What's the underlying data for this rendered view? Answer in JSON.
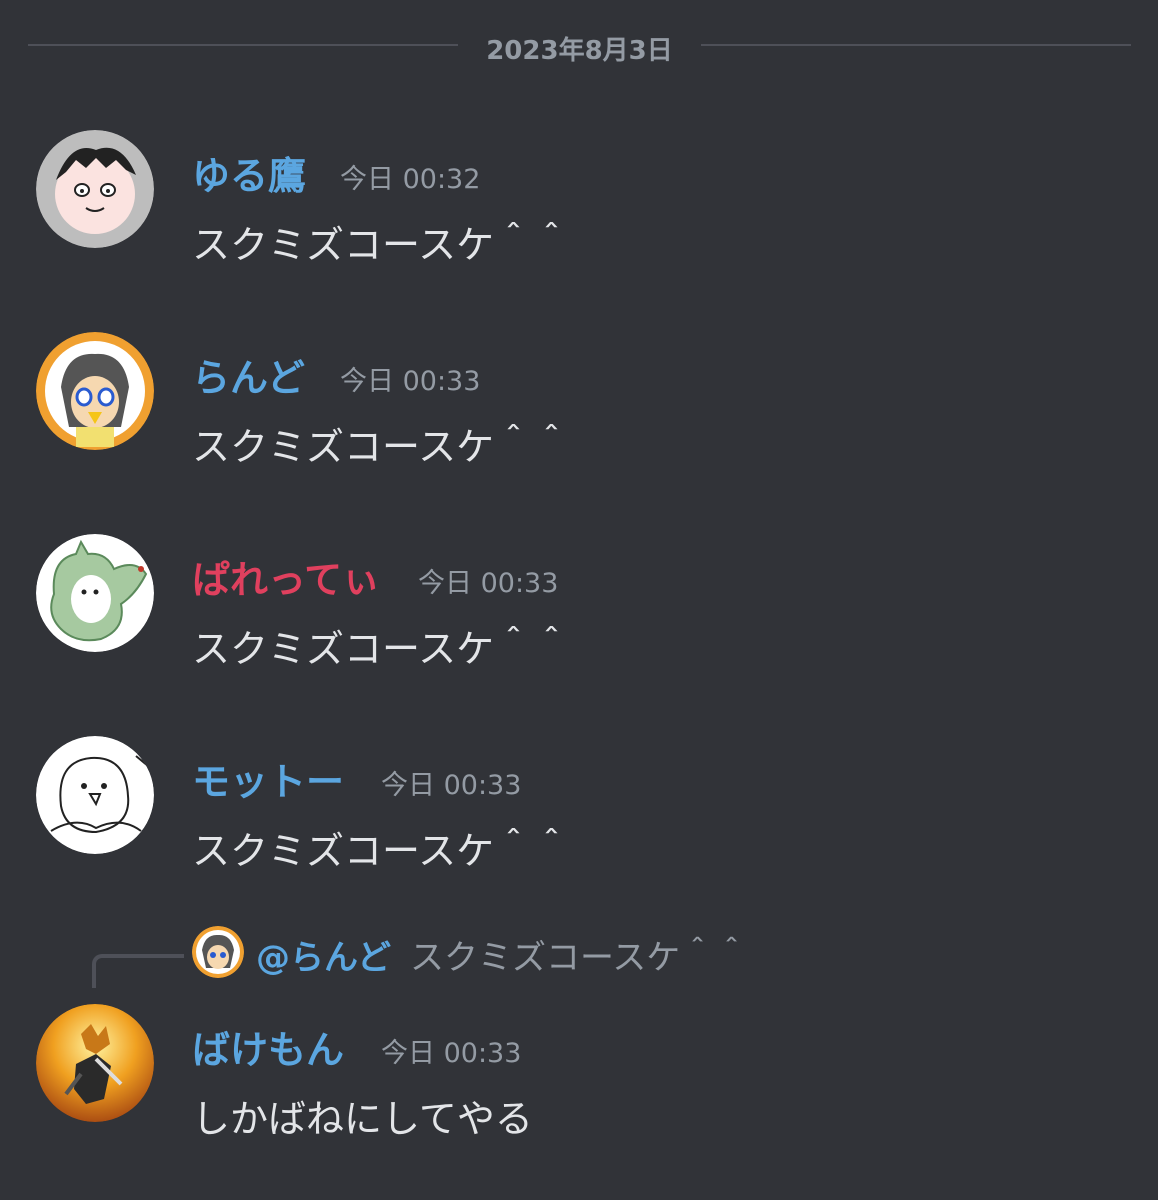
{
  "date_divider": "2023年8月3日",
  "messages": [
    {
      "author": "ゆる鷹",
      "color": "#5ba6e0",
      "time": "今日 00:32",
      "text": "スクミズコースケ＾＾",
      "avatar": "doodle-face-avatar"
    },
    {
      "author": "らんど",
      "color": "#5ba6e0",
      "time": "今日 00:33",
      "text": "スクミズコースケ＾＾",
      "avatar": "anime-character-avatar"
    },
    {
      "author": "ぱれってぃ",
      "color": "#e0405e",
      "time": "今日 00:33",
      "text": "スクミズコースケ＾＾",
      "avatar": "green-creature-avatar"
    },
    {
      "author": "モットー",
      "color": "#5ba6e0",
      "time": "今日 00:33",
      "text": "スクミズコースケ＾＾",
      "avatar": "penguin-sketch-avatar"
    },
    {
      "author": "ばけもん",
      "color": "#5ba6e0",
      "time": "今日 00:33",
      "text": "しかばねにしてやる",
      "avatar": "game-art-avatar",
      "reply": {
        "mention": "@らんど",
        "text": "スクミズコースケ＾＾"
      }
    }
  ]
}
